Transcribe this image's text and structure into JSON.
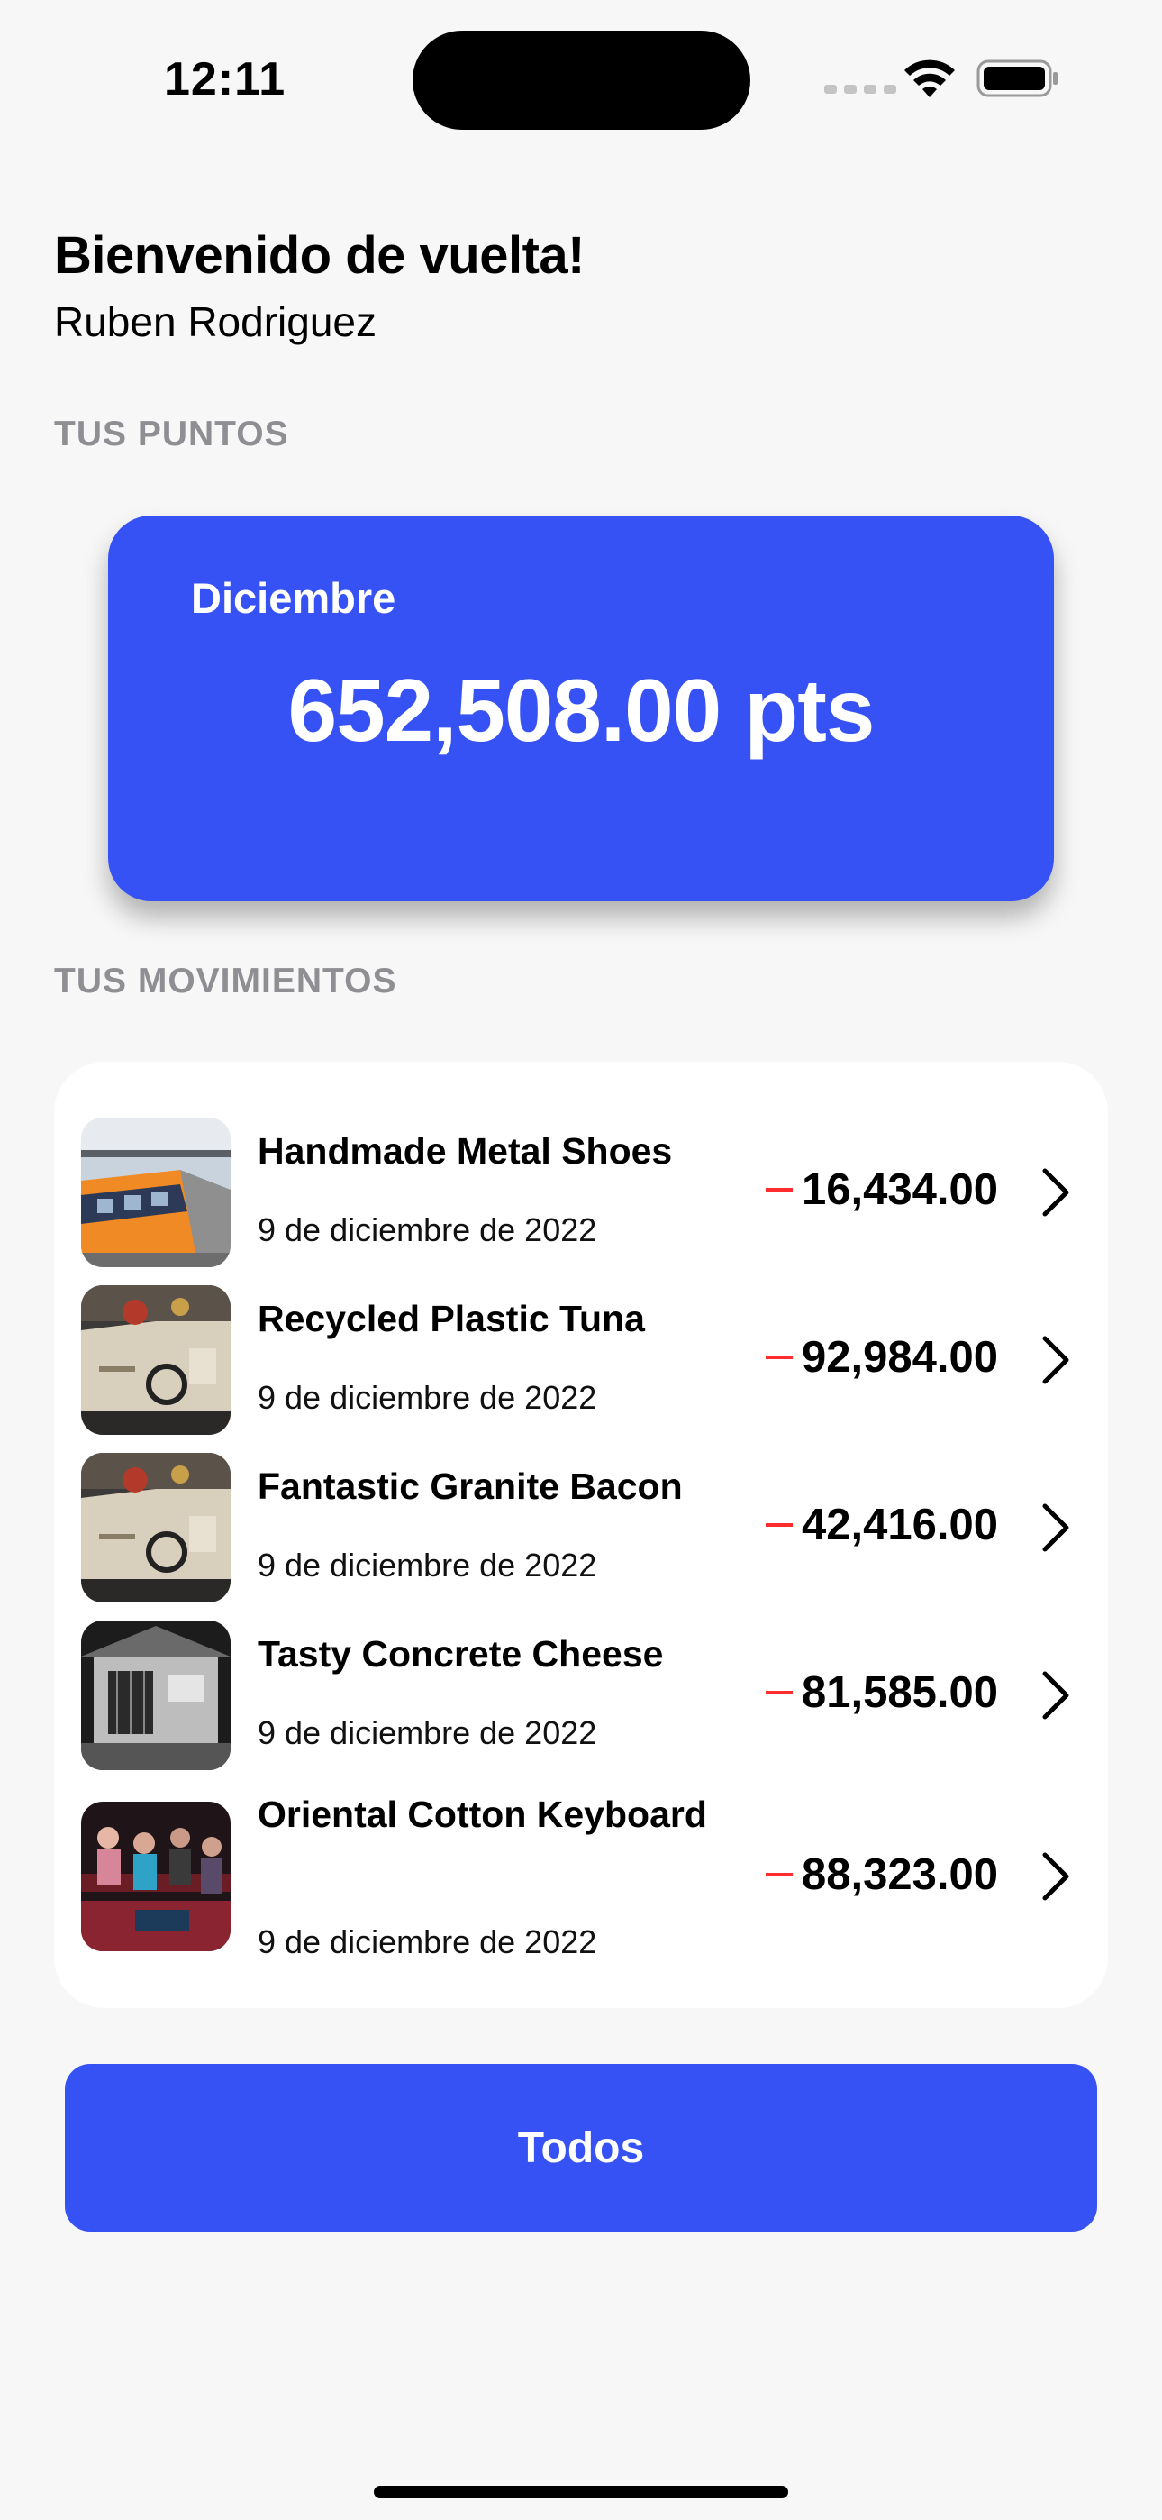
{
  "status_bar": {
    "time": "12:11"
  },
  "header": {
    "greeting": "Bienvenido de vuelta!",
    "user_name": "Ruben Rodriguez"
  },
  "points_section": {
    "label": "TUS PUNTOS",
    "month": "Diciembre",
    "points": "652,508.00 pts",
    "card_color": "#3652f5"
  },
  "movements_section": {
    "label": "TUS MOVIMIENTOS",
    "items": [
      {
        "title": "Handmade Metal Shoes",
        "date": "9 de diciembre de 2022",
        "amount": "16,434.00",
        "thumbnail": "train-station-photo"
      },
      {
        "title": "Recycled Plastic Tuna",
        "date": "9 de diciembre de 2022",
        "amount": "92,984.00",
        "thumbnail": "craft-table-photo"
      },
      {
        "title": "Fantastic Granite Bacon",
        "date": "9 de diciembre de 2022",
        "amount": "42,416.00",
        "thumbnail": "craft-table-photo"
      },
      {
        "title": "Tasty Concrete Cheese",
        "date": "9 de diciembre de 2022",
        "amount": "81,585.00",
        "thumbnail": "building-bw-photo"
      },
      {
        "title": "Oriental Cotton Keyboard",
        "date": "9 de diciembre de 2022",
        "amount": "88,323.00",
        "thumbnail": "audience-photo"
      }
    ]
  },
  "footer": {
    "all_button_label": "Todos"
  },
  "colors": {
    "accent": "#3652f5",
    "negative": "#ff2d2d",
    "section_label": "#8e8e93"
  }
}
